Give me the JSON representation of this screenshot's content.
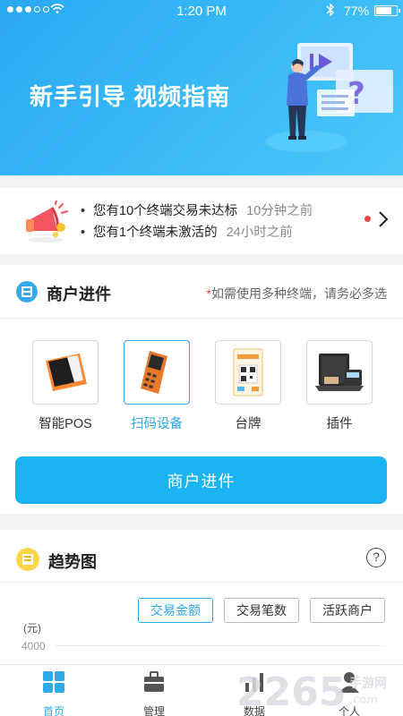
{
  "status_bar": {
    "time": "1:20 PM",
    "battery": "77%",
    "battery_level": 0.77
  },
  "banner": {
    "title": "新手引导 视频指南"
  },
  "notifications": [
    {
      "text": "您有10个终端交易未达标",
      "ago": "10分钟之前"
    },
    {
      "text": "您有1个终端未激活的",
      "ago": "24小时之前"
    }
  ],
  "merchant": {
    "title": "商户进件",
    "note_star": "*",
    "note": "如需使用多种终端，请务必多选",
    "devices": [
      {
        "label": "智能POS",
        "active": false
      },
      {
        "label": "扫码设备",
        "active": true
      },
      {
        "label": "台牌",
        "active": false
      },
      {
        "label": "插件",
        "active": false
      }
    ],
    "button": "商户进件"
  },
  "trend": {
    "title": "趋势图",
    "help": "?",
    "tabs": [
      "交易金额",
      "交易笔数",
      "活跃商户"
    ],
    "active_tab": 0,
    "y_unit": "(元)",
    "y_tick": "4000"
  },
  "tabbar": [
    {
      "label": "首页",
      "active": true
    },
    {
      "label": "管理",
      "active": false
    },
    {
      "label": "数据",
      "active": false
    },
    {
      "label": "个人",
      "active": false
    }
  ],
  "watermark": {
    "number": "2265",
    "site": "手游网",
    "domain": ".com"
  },
  "colors": {
    "primary": "#1bb3f2",
    "accent": "#2fa8e8",
    "alert": "#e84a4a"
  }
}
